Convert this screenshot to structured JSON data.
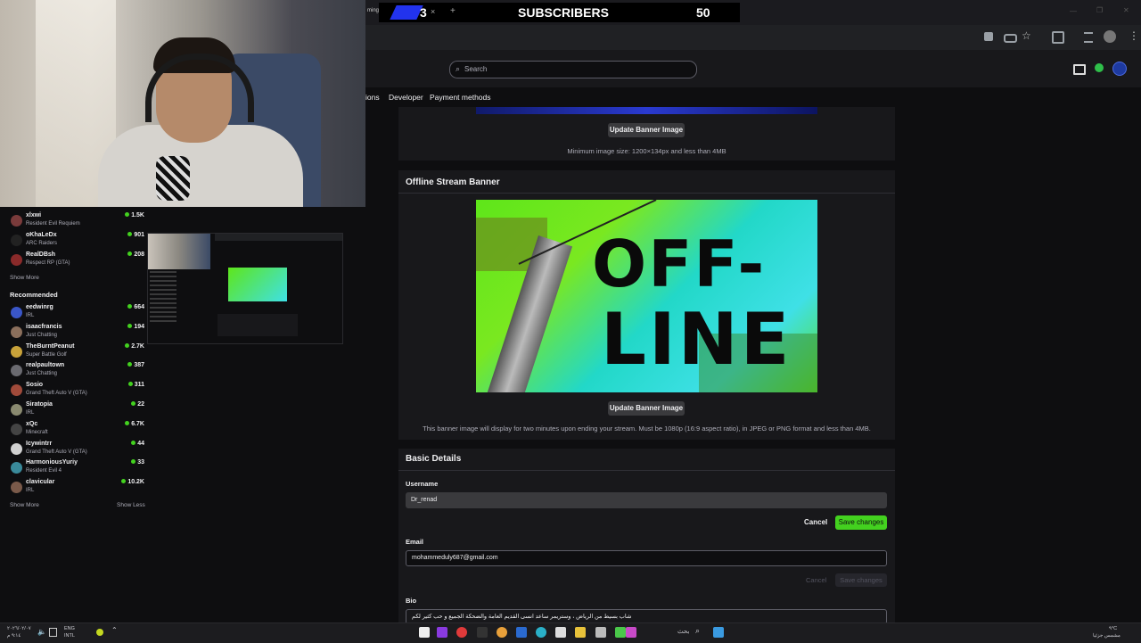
{
  "browser": {
    "tab_fragment": "ming",
    "tab_count": "3",
    "tab_close": "×",
    "tab_new": "+",
    "window_min": "—",
    "window_max": "❐",
    "window_close": "✕"
  },
  "overlay": {
    "subs_label": "SUBSCRIBERS",
    "subs_count": "50",
    "tab_number": "3"
  },
  "app": {
    "search_placeholder": "Search",
    "nav_tabs": [
      "ions",
      "Developer",
      "Payment methods"
    ]
  },
  "profile_banner": {
    "update_label": "Update Banner Image",
    "note": "Minimum image size: 1200×134px and less than 4MB"
  },
  "offline_banner": {
    "title": "Offline Stream Banner",
    "image_text_line1": "OFF-",
    "image_text_line2": "LINE",
    "update_label": "Update Banner Image",
    "note": "This banner image will display for two minutes upon ending your stream. Must be 1080p (16:9 aspect ratio), in JPEG or PNG format and less than 4MB."
  },
  "basic_details": {
    "title": "Basic Details",
    "username_label": "Username",
    "username_value": "Dr_renad",
    "cancel_label": "Cancel",
    "save_label": "Save changes",
    "email_label": "Email",
    "email_value": "mohammeduly687@gmail.com",
    "email_cancel_label": "Cancel",
    "email_save_label": "Save changes",
    "bio_label": "Bio",
    "bio_value": "شاب بسيط من الرياض ، وستريمر ساعد انسى القديم العامة والضحكة الجميع و حب كثير لكم"
  },
  "sidebar": {
    "followed": [
      {
        "name": "xlxwi",
        "game": "Resident Evil Requiem",
        "viewers": "1.5K",
        "color": "#7a3b3b"
      },
      {
        "name": "oKhaLeDx",
        "game": "ARC Raiders",
        "viewers": "901",
        "color": "#222"
      },
      {
        "name": "RealDBsh",
        "game": "Respect RP (GTA)",
        "viewers": "208",
        "color": "#8a2a2a"
      }
    ],
    "show_more_1": "Show More",
    "recommended_title": "Recommended",
    "recommended": [
      {
        "name": "eedwinrg",
        "game": "IRL",
        "viewers": "664",
        "color": "#3a56c8"
      },
      {
        "name": "isaacfrancis",
        "game": "Just Chatting",
        "viewers": "194",
        "color": "#8b6f5c"
      },
      {
        "name": "TheBurntPeanut",
        "game": "Super Battle Golf",
        "viewers": "2.7K",
        "color": "#c8a23a"
      },
      {
        "name": "realpaultown",
        "game": "Just Chatting",
        "viewers": "387",
        "color": "#6a6a70"
      },
      {
        "name": "Sosio",
        "game": "Grand Theft Auto V (GTA)",
        "viewers": "311",
        "color": "#a04a3a"
      },
      {
        "name": "Siratopia",
        "game": "IRL",
        "viewers": "22",
        "color": "#8a8a70"
      },
      {
        "name": "xQc",
        "game": "Minecraft",
        "viewers": "6.7K",
        "color": "#444"
      },
      {
        "name": "Icywintrr",
        "game": "Grand Theft Auto V (GTA)",
        "viewers": "44",
        "color": "#d0d0d0"
      },
      {
        "name": "HarmoniousYuriy",
        "game": "Resident Evil 4",
        "viewers": "33",
        "color": "#3a8a9a"
      },
      {
        "name": "clavicular",
        "game": "IRL",
        "viewers": "10.2K",
        "color": "#7a5a4a"
      }
    ],
    "show_more_2": "Show More",
    "show_less": "Show Less"
  },
  "taskbar": {
    "lang_line1": "ENG",
    "lang_line2": "INTL",
    "date_left": "٢٠٢٦/٠٢/٠٧",
    "time_left": "٩:١٤ م",
    "search_text": "بحث",
    "weather": "٩°C",
    "weather_desc": "مشمس جزئيا"
  }
}
